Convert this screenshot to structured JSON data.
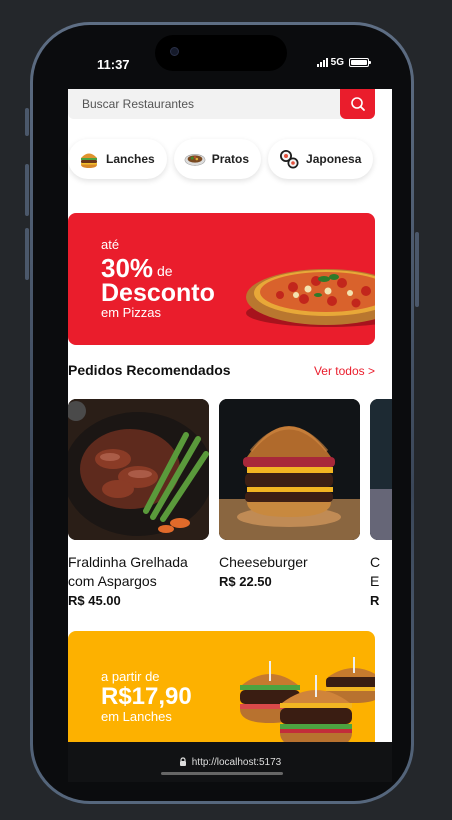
{
  "status": {
    "time": "11:37",
    "network": "5G",
    "battery_level": 1.0
  },
  "search": {
    "placeholder": "Buscar Restaurantes",
    "button_icon": "search-icon"
  },
  "categories": [
    {
      "label": "Lanches",
      "icon": "burger-icon"
    },
    {
      "label": "Pratos",
      "icon": "dish-icon"
    },
    {
      "label": "Japonesa",
      "icon": "sushi-icon"
    }
  ],
  "promo_banner": {
    "line1": "até",
    "percent": "30%",
    "de": "de",
    "headline": "Desconto",
    "subtitle": "em Pizzas",
    "bg_color": "#ea1d2c"
  },
  "recommended": {
    "title": "Pedidos Recomendados",
    "see_all": "Ver todos >",
    "items": [
      {
        "name": "Fraldinha Grelhada com Aspargos",
        "price": "R$ 45.00"
      },
      {
        "name": "Cheeseburger",
        "price": "R$ 22.50"
      },
      {
        "name": "C",
        "name2": "E",
        "price": "R"
      }
    ]
  },
  "promo_banner2": {
    "line1": "a partir de",
    "price": "R$17,90",
    "subtitle": "em Lanches",
    "bg_color": "#fdb100"
  },
  "url_bar": {
    "url": "http://localhost:5173",
    "icon": "lock-icon"
  },
  "accent_color": "#ea1d2c"
}
